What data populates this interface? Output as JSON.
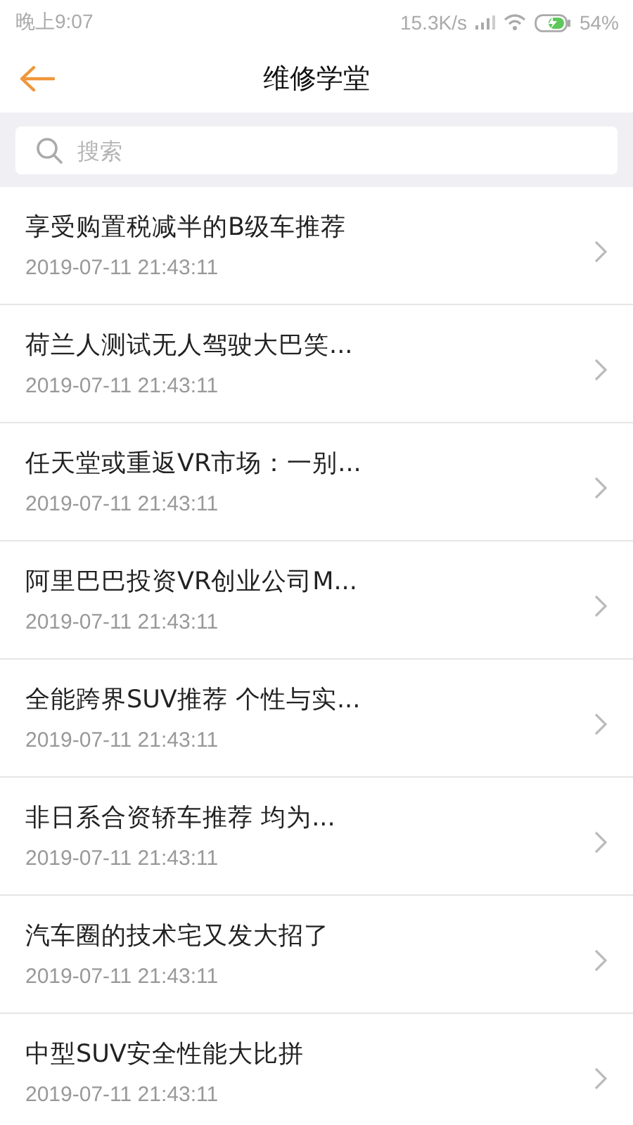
{
  "status_bar": {
    "time": "晚上9:07",
    "speed": "15.3K/s",
    "battery": "54%"
  },
  "header": {
    "title": "维修学堂"
  },
  "search": {
    "placeholder": "搜索"
  },
  "articles": [
    {
      "title": "享受购置税减半的B级车推荐",
      "date": "2019-07-11 21:43:11"
    },
    {
      "title": "荷兰人测试无人驾驶大巴笑...",
      "date": "2019-07-11 21:43:11"
    },
    {
      "title": "任天堂或重返VR市场：一别...",
      "date": "2019-07-11 21:43:11"
    },
    {
      "title": "阿里巴巴投资VR创业公司M...",
      "date": "2019-07-11 21:43:11"
    },
    {
      "title": "全能跨界SUV推荐 个性与实...",
      "date": "2019-07-11 21:43:11"
    },
    {
      "title": "非日系合资轿车推荐 均为...",
      "date": "2019-07-11 21:43:11"
    },
    {
      "title": "汽车圈的技术宅又发大招了",
      "date": "2019-07-11 21:43:11"
    },
    {
      "title": "中型SUV安全性能大比拼",
      "date": "2019-07-11 21:43:11"
    }
  ]
}
